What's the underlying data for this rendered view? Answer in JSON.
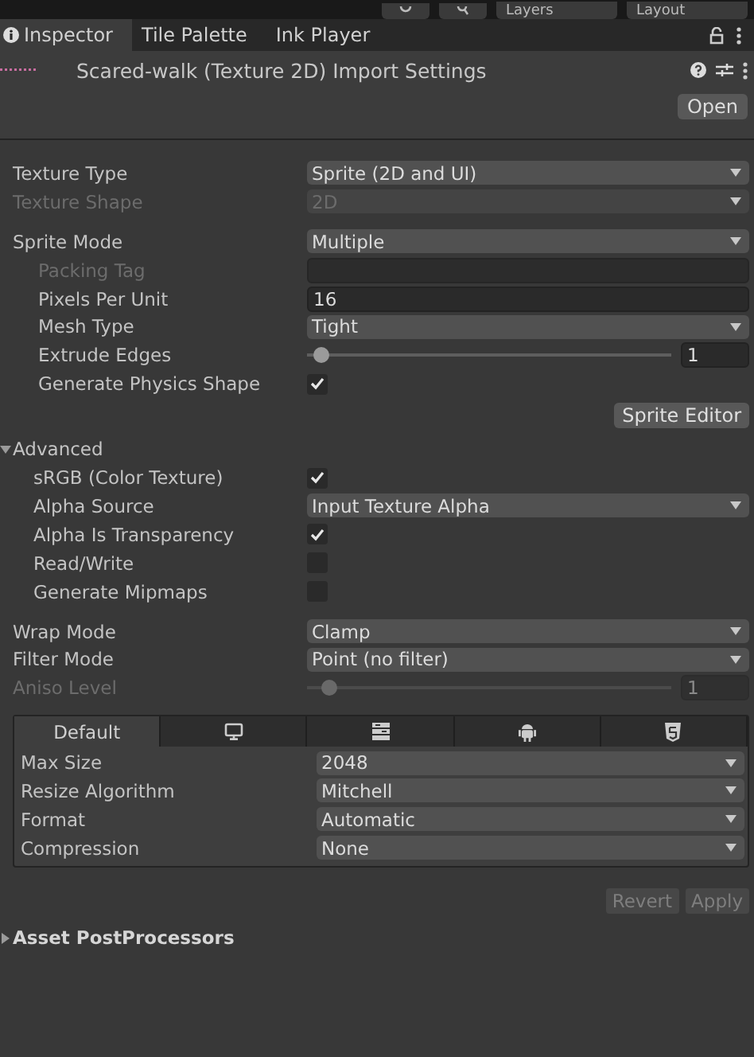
{
  "toolbar": {
    "dropdowns": [
      "Layers",
      "Layout"
    ]
  },
  "tabs": [
    {
      "label": "Inspector",
      "selected": true
    },
    {
      "label": "Tile Palette",
      "selected": false
    },
    {
      "label": "Ink Player",
      "selected": false
    }
  ],
  "header": {
    "title": "Scared-walk (Texture 2D) Import Settings",
    "button": "Open"
  },
  "settings": [
    {
      "kind": "dropdown",
      "label": "Texture Type",
      "value": "Sprite (2D and UI)",
      "disabled": false
    },
    {
      "kind": "dropdown",
      "label": "Texture Shape",
      "value": "2D",
      "disabled": true
    },
    {
      "kind": "spacer"
    },
    {
      "kind": "dropdown",
      "label": "Sprite Mode",
      "value": "Multiple",
      "disabled": false,
      "children": [
        {
          "kind": "text",
          "label": "Packing Tag",
          "disabled": true
        },
        {
          "kind": "text",
          "label": "Pixels Per Unit",
          "value": "16",
          "disabled": false
        },
        {
          "kind": "dropdown",
          "label": "Mesh Type",
          "value": "Tight",
          "disabled": false
        },
        {
          "kind": "slider",
          "label": "Extrude Edges",
          "level": 0.04,
          "value": "1",
          "disabled": false
        },
        {
          "kind": "checkbox",
          "label": "Generate Physics Shape",
          "checked": true,
          "disabled": false
        }
      ]
    },
    {
      "kind": "button",
      "label": "Sprite Editor"
    },
    {
      "kind": "foldout",
      "label": "Advanced",
      "expanded": true,
      "children": [
        {
          "kind": "checkbox",
          "label": "sRGB (Color Texture)",
          "checked": true,
          "disabled": false
        },
        {
          "kind": "dropdown",
          "label": "Alpha Source",
          "value": "Input Texture Alpha",
          "disabled": false
        },
        {
          "kind": "checkbox",
          "label": "Alpha Is Transparency",
          "checked": true,
          "disabled": false
        },
        {
          "kind": "checkbox",
          "label": "Read/Write",
          "checked": false,
          "disabled": false
        },
        {
          "kind": "checkbox",
          "label": "Generate Mipmaps",
          "checked": false,
          "disabled": false
        }
      ]
    },
    {
      "kind": "spacer"
    },
    {
      "kind": "dropdown",
      "label": "Wrap Mode",
      "value": "Clamp",
      "disabled": false
    },
    {
      "kind": "dropdown",
      "label": "Filter Mode",
      "value": "Point (no filter)",
      "disabled": false
    },
    {
      "kind": "slider",
      "label": "Aniso Level",
      "level": 0.06,
      "value": "1",
      "disabled": true
    }
  ],
  "platforms": {
    "tabs": [
      {
        "kind": "text",
        "label": "Default",
        "selected": true
      },
      {
        "kind": "monitor",
        "selected": false
      },
      {
        "kind": "server",
        "selected": false
      },
      {
        "kind": "android",
        "selected": false
      },
      {
        "kind": "html5",
        "selected": false
      }
    ],
    "rows": [
      {
        "label": "Max Size",
        "value": "2048"
      },
      {
        "label": "Resize Algorithm",
        "value": "Mitchell"
      },
      {
        "label": "Format",
        "value": "Automatic"
      },
      {
        "label": "Compression",
        "value": "None"
      }
    ]
  },
  "actions": [
    "Revert",
    "Apply"
  ],
  "postprocessors": {
    "label": "Asset PostProcessors",
    "expanded": false
  }
}
